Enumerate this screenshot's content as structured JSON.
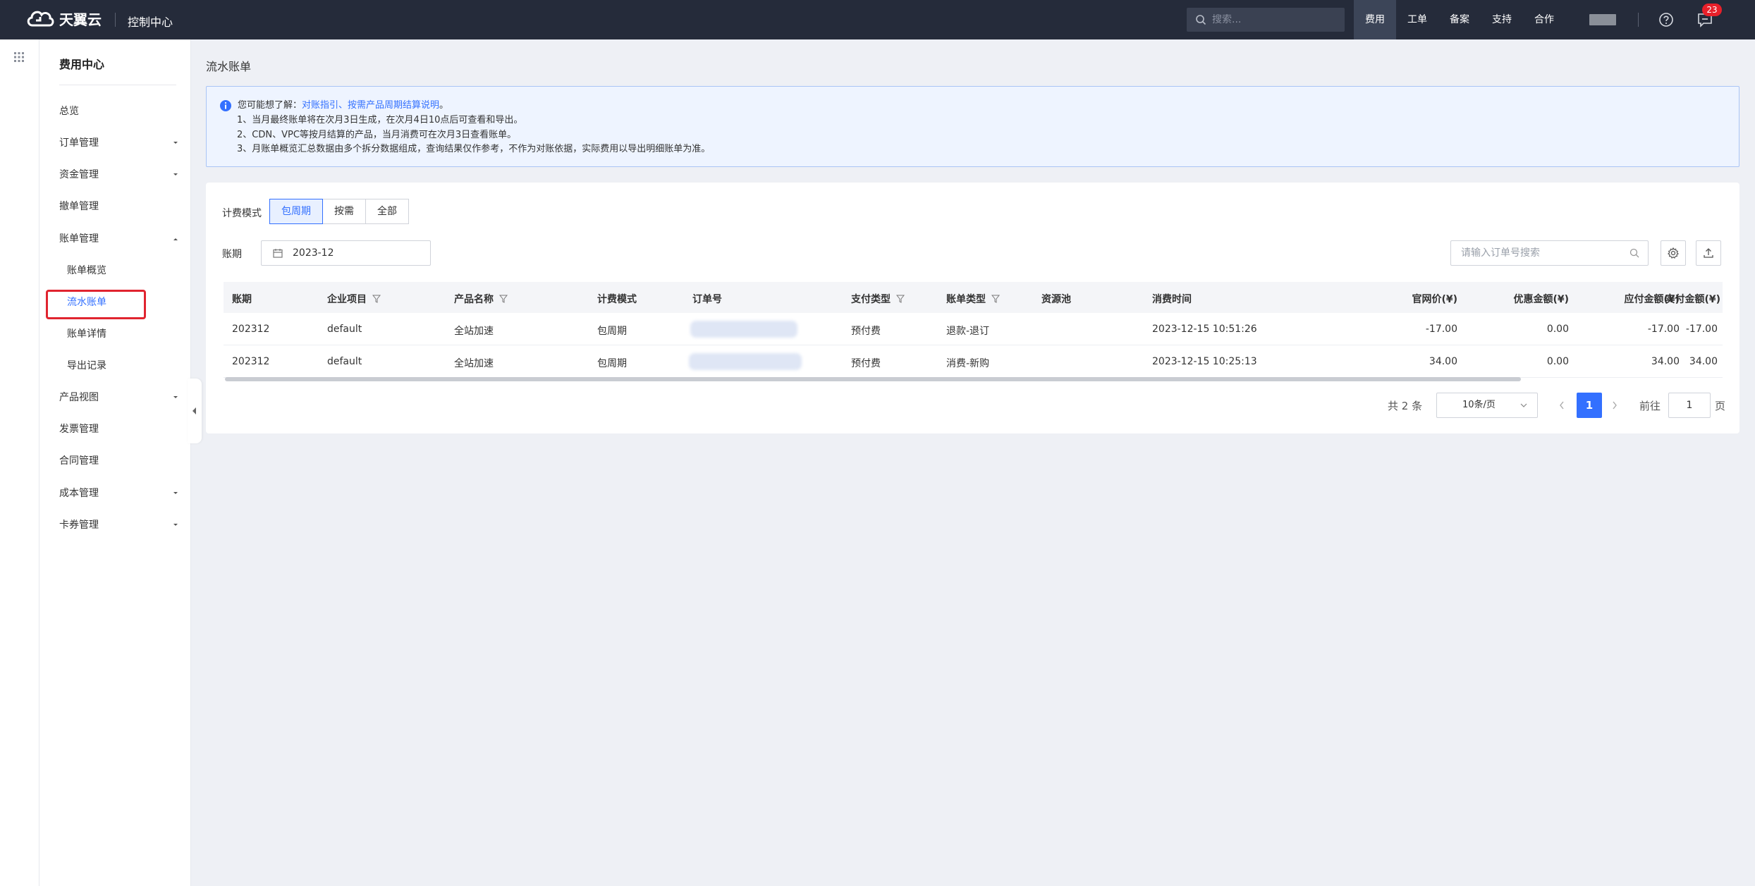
{
  "header": {
    "logo_text": "天翼云",
    "console_title": "控制中心",
    "search_placeholder": "搜索...",
    "nav": [
      "费用",
      "工单",
      "备案",
      "支持",
      "合作"
    ],
    "active_nav": "费用",
    "message_count": "23",
    "icons": [
      "cloud-logo-icon",
      "search-icon",
      "help-icon",
      "message-icon"
    ]
  },
  "sidebar": {
    "title": "费用中心",
    "items": [
      {
        "label": "总览",
        "expandable": false
      },
      {
        "label": "订单管理",
        "expandable": true
      },
      {
        "label": "资金管理",
        "expandable": true
      },
      {
        "label": "撤单管理",
        "expandable": false
      },
      {
        "label": "账单管理",
        "expandable": true,
        "expanded": true
      },
      {
        "label": "账单概览",
        "sub": true
      },
      {
        "label": "流水账单",
        "sub": true,
        "active": true
      },
      {
        "label": "账单详情",
        "sub": true
      },
      {
        "label": "导出记录",
        "sub": true
      },
      {
        "label": "产品视图",
        "expandable": true
      },
      {
        "label": "发票管理",
        "expandable": false
      },
      {
        "label": "合同管理",
        "expandable": false
      },
      {
        "label": "成本管理",
        "expandable": true
      },
      {
        "label": "卡券管理",
        "expandable": true
      }
    ]
  },
  "page": {
    "title": "流水账单",
    "notice": {
      "prefix": "您可能想了解：",
      "link": "对账指引、按需产品周期结算说明",
      "link_suffix": "。",
      "lines": [
        "1、当月最终账单将在次月3日生成，在次月4日10点后可查看和导出。",
        "2、CDN、VPC等按月结算的产品，当月消费可在次月3日查看账单。",
        "3、月账单概览汇总数据由多个拆分数据组成，查询结果仅作参考，不作为对账依据，实际费用以导出明细账单为准。"
      ]
    },
    "filters": {
      "billing_mode_label": "计费模式",
      "billing_modes": [
        "包周期",
        "按需",
        "全部"
      ],
      "active_mode": "包周期",
      "period_label": "账期",
      "period_value": "2023-12",
      "order_search_placeholder": "请输入订单号搜索"
    },
    "table": {
      "columns": [
        "账期",
        "企业项目",
        "产品名称",
        "计费模式",
        "订单号",
        "支付类型",
        "账单类型",
        "资源池",
        "消费时间",
        "官网价(¥)",
        "优惠金额(¥)",
        "应付金额(¥)",
        "实付金额(¥)"
      ],
      "rows": [
        [
          "202312",
          "default",
          "全站加速",
          "包周期",
          "",
          "预付费",
          "退款-退订",
          "",
          "2023-12-15 10:51:26",
          "-17.00",
          "0.00",
          "-17.00",
          "-17.00"
        ],
        [
          "202312",
          "default",
          "全站加速",
          "包周期",
          "",
          "预付费",
          "消费-新购",
          "",
          "2023-12-15 10:25:13",
          "34.00",
          "0.00",
          "34.00",
          "34.00"
        ]
      ]
    },
    "pagination": {
      "total": "共 2 条",
      "page_size": "10条/页",
      "current_page": "1",
      "goto_label": "前往",
      "goto_value": "1",
      "page_suffix": "页"
    }
  },
  "colors": {
    "accent": "#3370ff",
    "topbar": "#252b3a",
    "badge": "#e8202a",
    "highlight": "#e0242f"
  }
}
